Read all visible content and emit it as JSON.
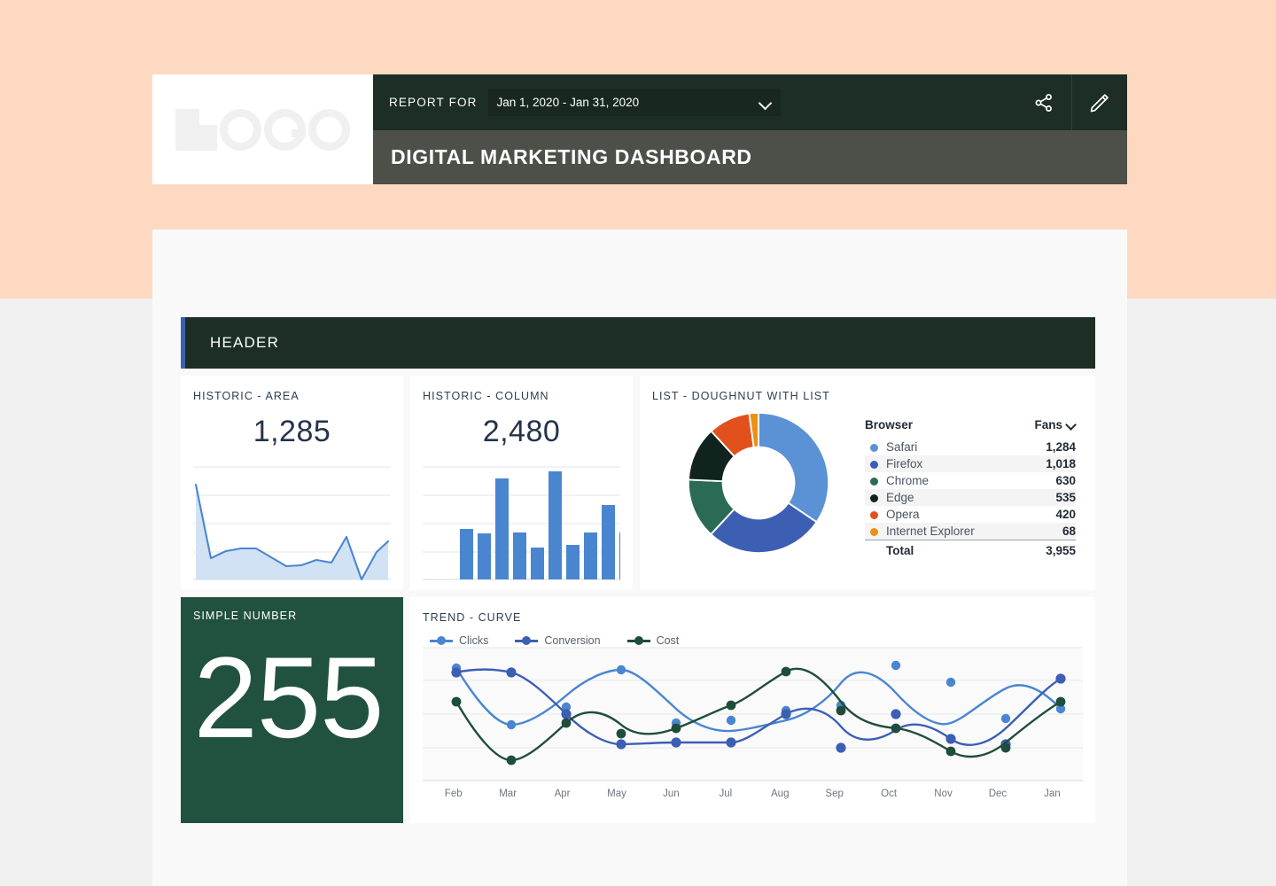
{
  "header": {
    "logo_alt": "LOGO",
    "report_for_label": "REPORT FOR",
    "date_range": "Jan 1, 2020 - Jan 31, 2020",
    "dashboard_title": "DIGITAL MARKETING DASHBOARD",
    "share_icon": "share-icon",
    "edit_icon": "pencil-icon"
  },
  "section": {
    "title": "HEADER",
    "accent_color": "#3d5fb3"
  },
  "cards": {
    "area": {
      "title": "HISTORIC - AREA",
      "value": "1,285"
    },
    "column": {
      "title": "HISTORIC - COLUMN",
      "value": "2,480"
    },
    "doughnut": {
      "title": "LIST - DOUGHNUT WITH LIST"
    },
    "simple": {
      "title": "SIMPLE NUMBER",
      "value": "255"
    },
    "trend": {
      "title": "TREND - CURVE"
    }
  },
  "browser_table": {
    "col_browser": "Browser",
    "col_fans": "Fans",
    "sort_icon": "chevron-down-icon",
    "rows": [
      {
        "name": "Safari",
        "fans": "1,284",
        "color": "#5b92d6"
      },
      {
        "name": "Firefox",
        "fans": "1,018",
        "color": "#3c5fb4"
      },
      {
        "name": "Chrome",
        "fans": "630",
        "color": "#2b6b56"
      },
      {
        "name": "Edge",
        "fans": "535",
        "color": "#11231d"
      },
      {
        "name": "Opera",
        "fans": "420",
        "color": "#e2511c"
      },
      {
        "name": "Internet Explorer",
        "fans": "68",
        "color": "#eb9113"
      }
    ],
    "total_label": "Total",
    "total_value": "3,955"
  },
  "chart_data": [
    {
      "type": "area",
      "title": "HISTORIC - AREA",
      "total": 1285,
      "categories": [
        "1",
        "2",
        "3",
        "4",
        "5",
        "6",
        "7",
        "8",
        "9",
        "10",
        "11",
        "12",
        "13",
        "14"
      ],
      "values": [
        95,
        22,
        30,
        30,
        22,
        12,
        13,
        17,
        26,
        20,
        19,
        55,
        2,
        46
      ],
      "ylim": [
        0,
        100
      ],
      "line_color": "#4a86d0",
      "fill_color": "#cfe0f4",
      "grid": true,
      "xlabel": "",
      "ylabel": ""
    },
    {
      "type": "bar",
      "title": "HISTORIC - COLUMN",
      "total": 2480,
      "categories": [
        "1",
        "2",
        "3",
        "4",
        "5",
        "6",
        "7",
        "8",
        "9",
        "10"
      ],
      "values": [
        43,
        39,
        87,
        40,
        27,
        94,
        30,
        40,
        65,
        40
      ],
      "ylim": [
        0,
        100
      ],
      "bar_color": "#4a86d0",
      "grid": true,
      "xlabel": "",
      "ylabel": ""
    },
    {
      "type": "pie",
      "title": "LIST - DOUGHNUT WITH LIST",
      "labels": [
        "Safari",
        "Firefox",
        "Chrome",
        "Edge",
        "Opera",
        "Internet Explorer"
      ],
      "values": [
        1284,
        1018,
        630,
        535,
        420,
        68
      ],
      "colors": [
        "#5b92d6",
        "#3c5fb4",
        "#2b6b56",
        "#11231d",
        "#e2511c",
        "#eb9113"
      ],
      "total": 3955,
      "donut_hole": 0.47
    },
    {
      "type": "line",
      "title": "TREND - CURVE",
      "x": [
        "Feb",
        "Mar",
        "Apr",
        "May",
        "Jun",
        "Jul",
        "Aug",
        "Sep",
        "Oct",
        "Nov",
        "Dec",
        "Jan"
      ],
      "series": [
        {
          "name": "Clicks",
          "color": "#4a86d0",
          "values": [
            86,
            41,
            55,
            82,
            43,
            45,
            52,
            56,
            86,
            73,
            46,
            53
          ]
        },
        {
          "name": "Conversion",
          "color": "#3c5fb4",
          "values": [
            83,
            81,
            45,
            26,
            27,
            27,
            45,
            20,
            45,
            35,
            23,
            67
          ]
        },
        {
          "name": "Cost",
          "color": "#1f4d3b",
          "values": [
            56,
            7,
            45,
            33,
            51,
            63,
            87,
            43,
            36,
            17,
            53,
            56
          ]
        }
      ],
      "ylim": [
        0,
        100
      ],
      "grid": true,
      "legend_position": "top-left",
      "xlabel": "",
      "ylabel": ""
    }
  ]
}
